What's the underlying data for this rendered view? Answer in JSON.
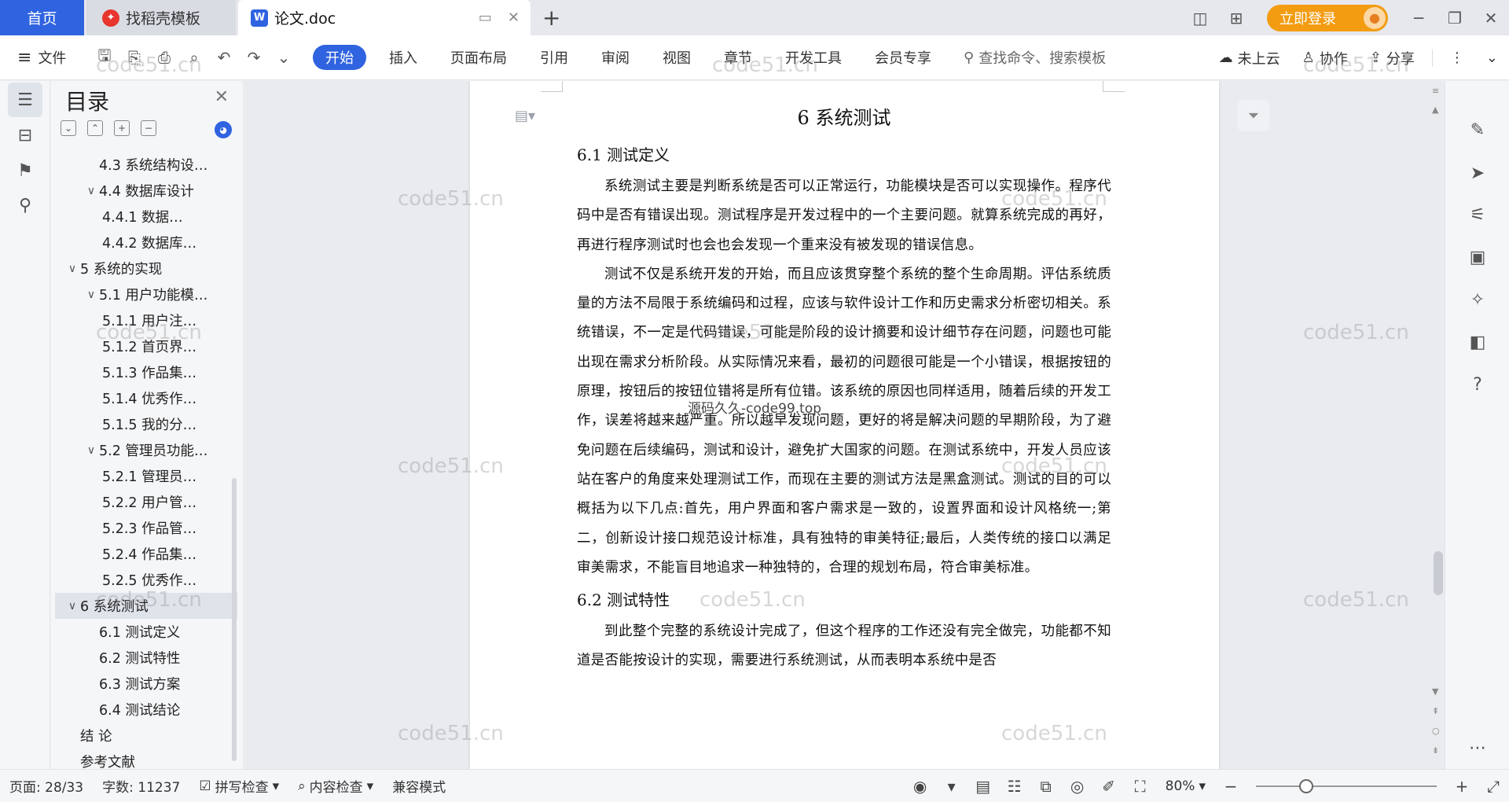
{
  "tabs": {
    "home": "首页",
    "template": "找稻壳模板",
    "doc": "论文.doc"
  },
  "titlebar": {
    "login": "立即登录"
  },
  "ribbon": {
    "file": "文件",
    "tabs": [
      "开始",
      "插入",
      "页面布局",
      "引用",
      "审阅",
      "视图",
      "章节",
      "开发工具",
      "会员专享"
    ],
    "search_placeholder": "查找命令、搜索模板",
    "cloud": "未上云",
    "collab": "协作",
    "share": "分享"
  },
  "toc": {
    "title": "目录",
    "items": [
      {
        "label": "4.3 系统结构设…",
        "level": 2
      },
      {
        "label": "4.4 数据库设计",
        "level": 2
      },
      {
        "label": "4.4.1 数据…",
        "level": 3
      },
      {
        "label": "4.4.2 数据库…",
        "level": 3
      },
      {
        "label": "5  系统的实现",
        "level": 1
      },
      {
        "label": "5.1 用户功能模…",
        "level": 2
      },
      {
        "label": "5.1.1 用户注…",
        "level": 3
      },
      {
        "label": "5.1.2 首页界…",
        "level": 3
      },
      {
        "label": "5.1.3 作品集…",
        "level": 3
      },
      {
        "label": "5.1.4 优秀作…",
        "level": 3
      },
      {
        "label": "5.1.5 我的分…",
        "level": 3
      },
      {
        "label": "5.2 管理员功能…",
        "level": 2
      },
      {
        "label": "5.2.1 管理员…",
        "level": 3
      },
      {
        "label": "5.2.2 用户管…",
        "level": 3
      },
      {
        "label": "5.2.3 作品管…",
        "level": 3
      },
      {
        "label": "5.2.4 作品集…",
        "level": 3
      },
      {
        "label": "5.2.5 优秀作…",
        "level": 3
      },
      {
        "label": "6 系统测试",
        "level": 1
      },
      {
        "label": "6.1 测试定义",
        "level": 2
      },
      {
        "label": "6.2 测试特性",
        "level": 2
      },
      {
        "label": "6.3 测试方案",
        "level": 2
      },
      {
        "label": "6.4 测试结论",
        "level": 2
      },
      {
        "label": "结  论",
        "level": 1
      },
      {
        "label": "参考文献",
        "level": 1
      }
    ]
  },
  "document": {
    "h1": "6 系统测试",
    "h2_1": "6.1 测试定义",
    "p1": "系统测试主要是判断系统是否可以正常运行，功能模块是否可以实现操作。程序代码中是否有错误出现。测试程序是开发过程中的一个主要问题。就算系统完成的再好，再进行程序测试时也会也会发现一个重来没有被发现的错误信息。",
    "p2": "测试不仅是系统开发的开始，而且应该贯穿整个系统的整个生命周期。评估系统质量的方法不局限于系统编码和过程，应该与软件设计工作和历史需求分析密切相关。系统错误，不一定是代码错误，可能是阶段的设计摘要和设计细节存在问题，问题也可能出现在需求分析阶段。从实际情况来看，最初的问题很可能是一个小错误，根据按钮的原理，按钮后的按钮位错将是所有位错。该系统的原因也同样适用，随着后续的开发工作，误差将越来越严重。所以越早发现问题，更好的将是解决问题的早期阶段，为了避免问题在后续编码，测试和设计，避免扩大国家的问题。在测试系统中，开发人员应该站在客户的角度来处理测试工作，而现在主要的测试方法是黑盒测试。测试的目的可以概括为以下几点:首先，用户界面和客户需求是一致的，设置界面和设计风格统一;第二，创新设计接口规范设计标准，具有独特的审美特征;最后，人类传统的接口以满足审美需求，不能盲目地追求一种独特的，合理的规划布局，符合审美标准。",
    "h2_2": "6.2 测试特性",
    "p3": "到此整个完整的系统设计完成了，但这个程序的工作还没有完全做完，功能都不知道是否能按设计的实现，需要进行系统测试，从而表明本系统中是否"
  },
  "watermarks": {
    "site": "code51.cn",
    "center": "源码久久-code99.top"
  },
  "statusbar": {
    "page": "页面: 28/33",
    "words": "字数: 11237",
    "spell": "拼写检查",
    "content": "内容检查",
    "compat": "兼容模式",
    "zoom": "80%",
    "zoom_level": 0.28
  }
}
